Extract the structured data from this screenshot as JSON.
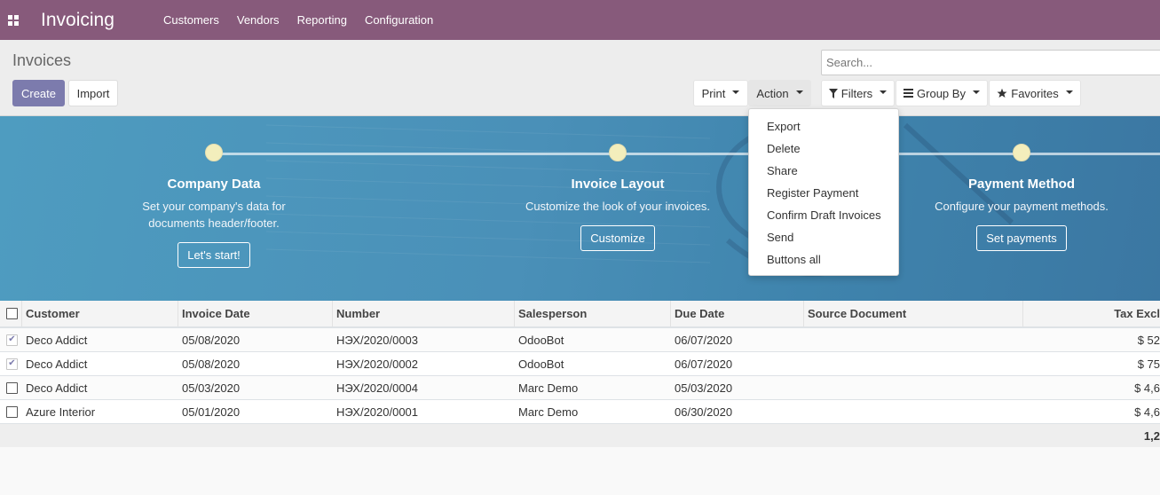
{
  "navbar": {
    "apps_icon": "grid-icon",
    "app_name": "Invoicing",
    "menu": [
      "Customers",
      "Vendors",
      "Reporting",
      "Configuration"
    ]
  },
  "control_panel": {
    "title": "Invoices",
    "create_label": "Create",
    "import_label": "Import",
    "search_placeholder": "Search...",
    "print_label": "Print",
    "action_label": "Action",
    "filters_label": "Filters",
    "groupby_label": "Group By",
    "favorites_label": "Favorites"
  },
  "action_menu": [
    "Export",
    "Delete",
    "Share",
    "Register Payment",
    "Confirm Draft Invoices",
    "Send",
    "Buttons all"
  ],
  "onboarding": {
    "steps": [
      {
        "title": "Company Data",
        "desc_line1": "Set your company's data for",
        "desc_line2": "documents header/footer.",
        "button": "Let's start!"
      },
      {
        "title": "Invoice Layout",
        "desc_line1": "Customize the look of your invoices.",
        "desc_line2": "",
        "button": "Customize"
      },
      {
        "title": "Payment Method",
        "desc_line1": "Configure your payment methods.",
        "desc_line2": "",
        "button": "Set payments"
      }
    ]
  },
  "table": {
    "columns": [
      "Customer",
      "Invoice Date",
      "Number",
      "Salesperson",
      "Due Date",
      "Source Document",
      "Tax Excl"
    ],
    "rows": [
      {
        "checked": true,
        "customer": "Deco Addict",
        "invoice_date": "05/08/2020",
        "number": "НЭХ/2020/0003",
        "salesperson": "OdooBot",
        "due_date": "06/07/2020",
        "source": "",
        "tax_excl": "$ 52"
      },
      {
        "checked": true,
        "customer": "Deco Addict",
        "invoice_date": "05/08/2020",
        "number": "НЭХ/2020/0002",
        "salesperson": "OdooBot",
        "due_date": "06/07/2020",
        "source": "",
        "tax_excl": "$ 75"
      },
      {
        "checked": false,
        "customer": "Deco Addict",
        "invoice_date": "05/03/2020",
        "number": "НЭХ/2020/0004",
        "salesperson": "Marc Demo",
        "due_date": "05/03/2020",
        "source": "",
        "tax_excl": "$ 4,6"
      },
      {
        "checked": false,
        "customer": "Azure Interior",
        "invoice_date": "05/01/2020",
        "number": "НЭХ/2020/0001",
        "salesperson": "Marc Demo",
        "due_date": "06/30/2020",
        "source": "",
        "tax_excl": "$ 4,6"
      }
    ],
    "total": "1,2"
  },
  "colors": {
    "navbar": "#875a7b",
    "primary_button": "#7c7bad",
    "banner": "#4a90b8"
  }
}
